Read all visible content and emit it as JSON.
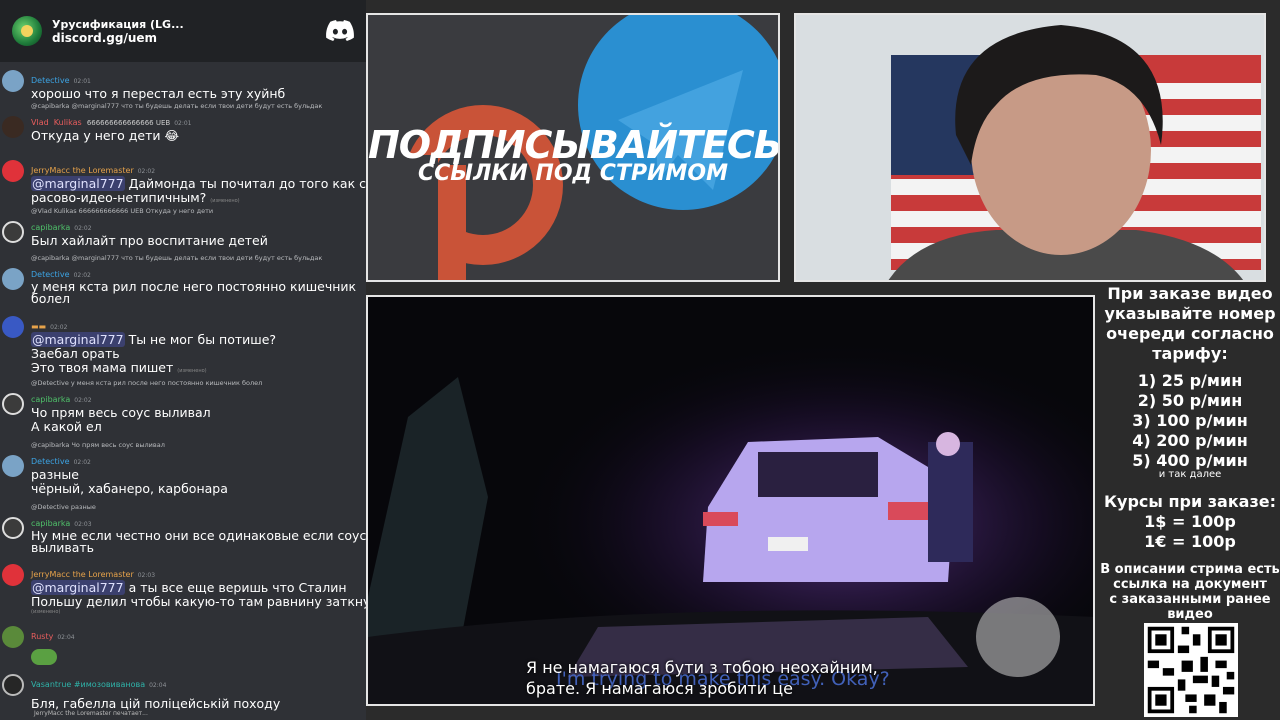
{
  "chat": {
    "server_title": "Урусификация (LG...",
    "invite": "discord.gg/uem",
    "messages": [
      {
        "user": "Detective",
        "time": "02:01",
        "text": "хорошо что я перестал есть эту хуйнб"
      },
      {
        "reply": "@capibarka @marginal777 что ты будешь делать если твои дети будут есть бульдак",
        "user": "Vlad",
        "user2": "Kulikas",
        "decor": "666666666666666 UEB",
        "time": "02:01",
        "text": "Откуда у него дети"
      },
      {
        "user": "JerryMacc the Loremaster",
        "time": "02:02",
        "mention": "@marginal777",
        "text": "Даймонда ты почитал до того как стал",
        "text2": "расово-идео-нетипичным?",
        "edited": "(изменено)"
      },
      {
        "reply": "@Vlad Kulikas 666666666666 UEB Откуда у него дети",
        "user": "capibarka",
        "time": "02:02",
        "text": "Был хайлайт про воспитание детей"
      },
      {
        "reply": "@capibarka @marginal777 что ты будешь делать если твои дети будут есть бульдак",
        "user": "Detective",
        "time": "02:02",
        "text": "у меня кста рил после него постоянно кишечник",
        "text2": "болел"
      },
      {
        "time": "02:02",
        "mention": "@marginal777",
        "text": "Ты не мог бы потише?",
        "text2": "Заебал орать",
        "text3": "Это твоя мама пишет",
        "edited": "(изменено)"
      },
      {
        "reply": "@Detective у меня кста рил после него постоянно кишечник болел",
        "user": "capibarka",
        "time": "02:02",
        "text": "Чо прям весь соус выливал",
        "text2": "А какой ел"
      },
      {
        "reply": "@capibarka Чо прям весь соус выливал",
        "user": "Detective",
        "time": "02:02",
        "text": "разные",
        "text2": "чёрный, хабанеро, карбонара"
      },
      {
        "reply": "@Detective разные",
        "user": "capibarka",
        "time": "02:03",
        "text": "Ну мне если честно они все одинаковые если соус",
        "text2": "выливать"
      },
      {
        "user": "JerryMacc the Loremaster",
        "time": "02:03",
        "mention": "@marginal777",
        "text": "а ты все еще веришь что Сталин",
        "text2": "Польшу делил чтобы какую-то там равнину заткнуть?",
        "edited": "(изменено)"
      },
      {
        "user": "Rusty",
        "time": "02:04"
      },
      {
        "user": "Vasantrue #имозовиванова",
        "time": "02:04",
        "text": "Бля, габелла цій поліцейській походу"
      }
    ],
    "typing": "JerryMacc the Loremaster печатает..."
  },
  "promo": {
    "title": "ПОДПИСЫВАЙТЕСЬ",
    "subtitle": "ССЫЛКИ ПОД СТРИМОМ"
  },
  "video": {
    "subtitle_line1": "Я не намагаюся бути з тобою неохайним,",
    "subtitle_line2": "брате. Я намагаюся зробити це",
    "subtitle_en": "I'm trying to make this easy. Okay?"
  },
  "info": {
    "intro": [
      "При заказе видео",
      "указывайте номер",
      "очереди согласно",
      "тарифу:"
    ],
    "tariffs": [
      "1) 25 р/мин",
      "2) 50 р/мин",
      "3) 100 р/мин",
      "4) 200 р/мин",
      "5) 400 р/мин"
    ],
    "etc": "и так далее",
    "rates_title": "Курсы при заказе:",
    "rates": [
      "1$ = 100р",
      "1€ = 100р"
    ],
    "doc_note": [
      "В описании стрима есть",
      "ссылка на документ",
      "с заказанными ранее",
      "видео"
    ]
  },
  "colors": {
    "chat_bg": "#2f3136",
    "header_bg": "#202225",
    "discord_blurple": "#5865f2",
    "telegram_blue": "#2d9ee0",
    "patreon_orange": "#d9533a"
  }
}
